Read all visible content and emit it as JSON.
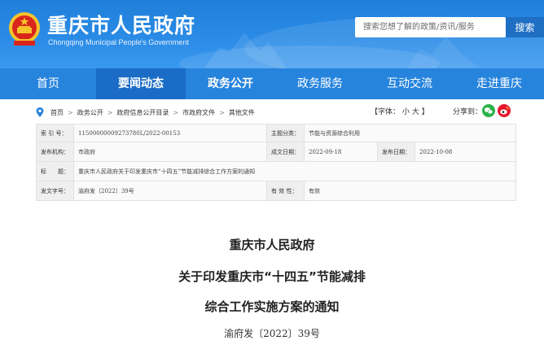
{
  "header": {
    "title": "重庆市人民政府",
    "subtitle": "Chongqing Municipal People's Government",
    "search_placeholder": "搜索您想了解的政策/资讯/服务",
    "search_button": "搜索"
  },
  "nav": {
    "items": [
      "首页",
      "要闻动态",
      "政务公开",
      "政务服务",
      "互动交流",
      "走进重庆"
    ]
  },
  "breadcrumb": [
    "首页",
    "政务公开",
    "政府信息公开目录",
    "市政府文件",
    "其他文件"
  ],
  "font_size": {
    "label": "【字体：",
    "small": "小",
    "large": "大",
    "close": "】"
  },
  "share": {
    "label": "分享到："
  },
  "meta": {
    "index_key": "索 引 号：",
    "index_val": "11500000009273780L/2022-00153",
    "topic_key": "主题分类：",
    "topic_val": "节能与资源综合利用",
    "issuer_key": "发布机构：",
    "issuer_val": "市政府",
    "created_key": "成文日期：",
    "created_val": "2022-09-18",
    "published_key": "发布日期：",
    "published_val": "2022-10-08",
    "title_key": "标　　题：",
    "title_val": "重庆市人民政府关于印发重庆市“十四五”节能减排综合工作方案的通知",
    "docno_key": "发文字号：",
    "docno_val": "渝府发〔2022〕39号",
    "validity_key": "有 效 性：",
    "validity_val": "有效"
  },
  "document": {
    "line1": "重庆市人民政府",
    "line2": "关于印发重庆市“十四五”节能减排",
    "line3": "综合工作实施方案的通知",
    "number": "渝府发〔2022〕39号"
  },
  "colors": {
    "header_blue": "#2a8be6",
    "nav_active": "#1a6cc6",
    "search_button": "#1e6fc4",
    "emblem_red": "#d8261c",
    "emblem_gold": "#f6c42b"
  },
  "icons": [
    "location-icon",
    "wechat-icon",
    "weibo-icon",
    "national-emblem-icon"
  ]
}
